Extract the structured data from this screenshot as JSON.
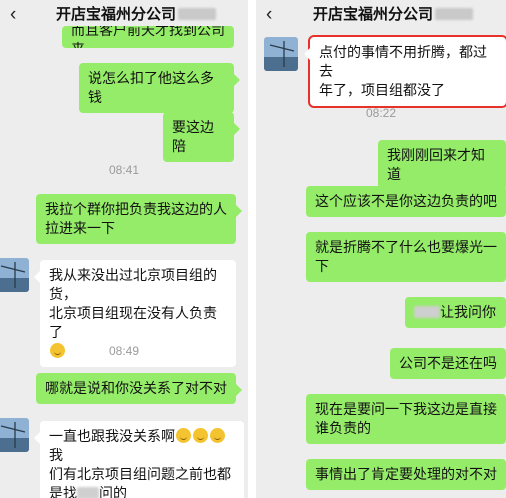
{
  "left_panel": {
    "back_icon": "chevron-left-icon",
    "title": "开店宝福州分公司",
    "messages": {
      "m1": "而且客户前天才找到公司来",
      "m2": "说怎么扣了他这么多钱",
      "m3": "要这边陪",
      "t1": "08:41",
      "m4a": "我拉个群你把负责我这边的人",
      "m4b": "拉进来一下",
      "m5a": "我从来没出过北京项目组的货，",
      "m5b": "北京项目组现在没有人负责了",
      "t2": "08:49",
      "m6": "哪就是说和你没关系了对不对",
      "m7a": "一直也跟我没关系啊",
      "m7b": "我",
      "m7c": "们有北京项目组问题之前也都",
      "m7d": "是找",
      "m7e": "问的"
    }
  },
  "right_panel": {
    "back_icon": "chevron-left-icon",
    "title": "开店宝福州分公司",
    "messages": {
      "r1a": "点付的事情不用折腾，都过去",
      "r1b": "年了，项目组都没了",
      "t1": "08:22",
      "r2": "我刚刚回来才知道",
      "r3": "这个应该不是你这边负责的吧",
      "r4a": "就是折腾不了什么也要爆光一",
      "r4b": "下",
      "r5": "让我问你",
      "r6": "公司不是还在吗",
      "r7a": "现在是要问一下我这边是直接",
      "r7b": "谁负责的",
      "r8": "事情出了肯定要处理的对不对"
    }
  },
  "colors": {
    "sent_bubble": "#95ec69",
    "received_bubble": "#ffffff",
    "chat_bg": "#ededed",
    "highlight": "#e8312a"
  }
}
